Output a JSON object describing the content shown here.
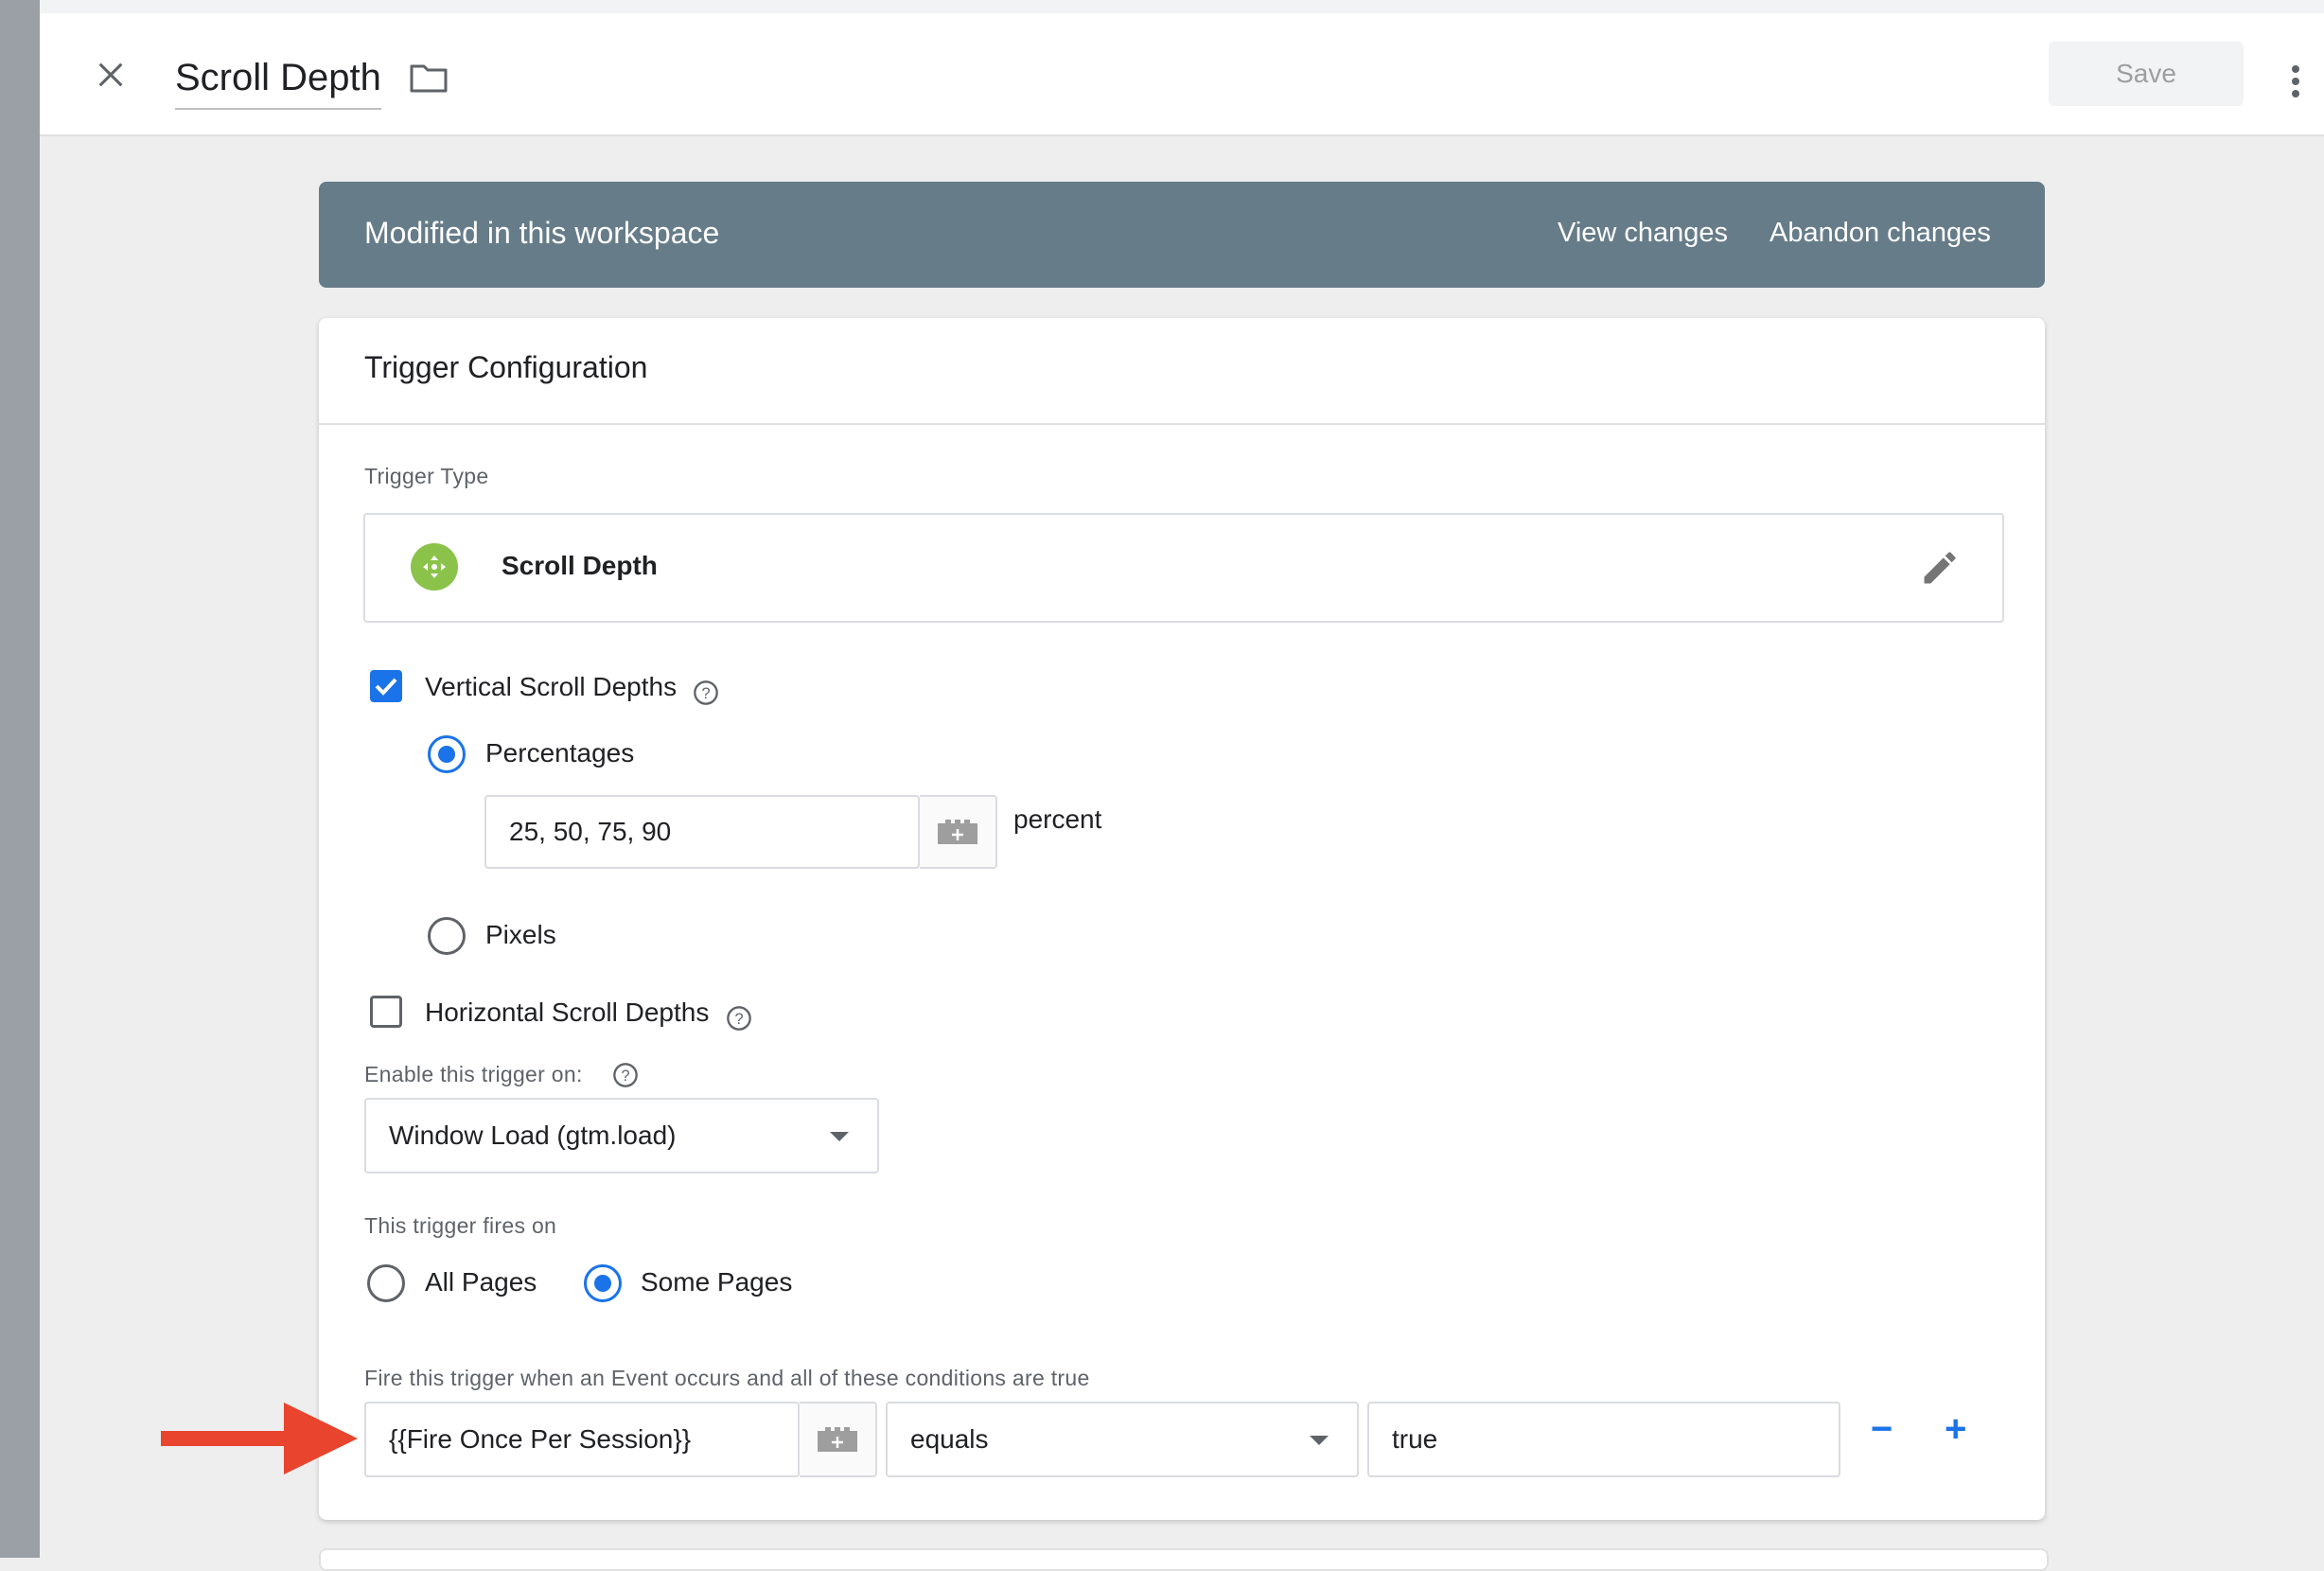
{
  "header": {
    "title": "Scroll Depth",
    "save_label": "Save"
  },
  "banner": {
    "text": "Modified in this workspace",
    "view_changes": "View changes",
    "abandon_changes": "Abandon changes"
  },
  "card": {
    "title": "Trigger Configuration",
    "trigger_type_label": "Trigger Type",
    "trigger_type_name": "Scroll Depth",
    "vertical": {
      "label": "Vertical Scroll Depths",
      "checked": true,
      "percentages_label": "Percentages",
      "percentages_value": "25, 50, 75, 90",
      "percent_unit": "percent",
      "pixels_label": "Pixels"
    },
    "horizontal": {
      "label": "Horizontal Scroll Depths",
      "checked": false
    },
    "enable_label": "Enable this trigger on:",
    "enable_value": "Window Load (gtm.load)",
    "fires_on_label": "This trigger fires on",
    "all_pages_label": "All Pages",
    "some_pages_label": "Some Pages",
    "conditions_label": "Fire this trigger when an Event occurs and all of these conditions are true",
    "condition": {
      "variable": "{{Fire Once Per Session}}",
      "operator": "equals",
      "value": "true",
      "remove_label": "−",
      "add_label": "+"
    }
  },
  "colors": {
    "banner": "#667c89",
    "accent": "#1a73e8",
    "trigger_icon": "#8bc34a",
    "arrow": "#e8442e"
  },
  "icons": [
    "close-icon",
    "folder-icon",
    "more-vert-icon",
    "scroll-depth-icon",
    "pencil-icon",
    "help-icon",
    "variable-icon",
    "dropdown-caret-icon",
    "annotation-arrow"
  ]
}
